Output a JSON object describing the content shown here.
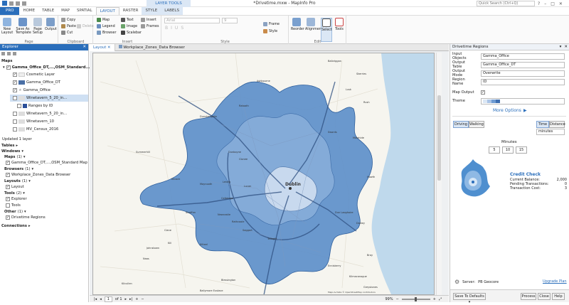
{
  "window": {
    "title": "*Drivetime.mxw - MapInfo Pro",
    "search_placeholder": "Quick Search (Ctrl+Q)",
    "contextual_tab": "LAYER TOOLS"
  },
  "ribbon_tabs": [
    "PRO",
    "HOME",
    "TABLE",
    "MAP",
    "SPATIAL",
    "LAYOUT",
    "RASTER",
    "STYLE",
    "LABELS"
  ],
  "ribbon": {
    "page": {
      "label": "Page",
      "new_layout": "New Layout",
      "save_as_template": "Save As Template",
      "page_setup": "Page Setup",
      "output": "Output"
    },
    "clipboard": {
      "label": "Clipboard",
      "copy": "Copy",
      "paste": "Paste",
      "cut": "Cut",
      "delete": "Delete"
    },
    "insert": {
      "label": "Insert",
      "map": "Map",
      "legend": "Legend",
      "browser": "Browser",
      "text": "Text",
      "image": "Image",
      "scalebar": "Scalebar",
      "insert": "Insert",
      "frames": "Frames"
    },
    "style": {
      "label": "Style",
      "font": "Arial",
      "size": "9",
      "frame": "Frame",
      "style": "Style"
    },
    "edit": {
      "label": "Edit",
      "reorder": "Reorder",
      "alignment": "Alignment",
      "select": "Select",
      "tools": "Tools"
    }
  },
  "explorer": {
    "title": "Explorer",
    "maps_header": "Maps",
    "map_name": "Gamma_Office_DT,...,OSM_Standard...",
    "layers": [
      {
        "name": "Cosmetic Layer",
        "checked": true
      },
      {
        "name": "Gamma_Office_DT",
        "checked": true
      },
      {
        "name": "Gamma_Office",
        "checked": true
      },
      {
        "name": "Winetavern_5_20_in...",
        "checked": false,
        "selected": true
      },
      {
        "name": "Ranges by ID",
        "checked": false
      },
      {
        "name": "Winetavern_5_20_in...",
        "checked": false
      },
      {
        "name": "Winetavern_10",
        "checked": false
      },
      {
        "name": "MV_Census_2016",
        "checked": false
      }
    ],
    "status": "Updated 1 layer",
    "tables_header": "Tables",
    "windows_header": "Windows",
    "maps_group": "Maps",
    "maps_count": "(1)",
    "maps_item": "Gamma_Office_DT,...,OSM_Standard Map",
    "browsers_group": "Browsers",
    "browsers_count": "(1)",
    "browsers_item": "Workplace_Zones_Data Browser",
    "layouts_group": "Layouts",
    "layouts_count": "(1)",
    "layouts_item": "Layout",
    "tools_group": "Tools",
    "tools_count": "(2)",
    "tools_items": [
      "Explorer",
      "Tools"
    ],
    "other_group": "Other",
    "other_count": "(1)",
    "other_item": "Drivetime Regions",
    "connections_header": "Connections"
  },
  "doc_tabs": [
    "Layout",
    "Workplace_Zones_Data Browser"
  ],
  "map": {
    "places": [
      "Dublin",
      "Skerries",
      "Balbriggan",
      "Rush",
      "Lusk",
      "Swords",
      "Malahide",
      "Howth",
      "Dunboyne",
      "Clonee",
      "Lucan",
      "Maynooth",
      "Leixlip",
      "Kilcock",
      "Celbridge",
      "Straffan",
      "Clane",
      "Naas",
      "Kill",
      "Johnstown",
      "Newcastle",
      "Rathcoole",
      "Saggart",
      "Tallaght",
      "Blessington",
      "Enniskerry",
      "Bray",
      "Greystones",
      "Dalkey",
      "Dun Laoghaire",
      "Ashbourne",
      "Ratoath",
      "Dunshaughlin",
      "Summerhill",
      "Kilcullen",
      "Kilteel",
      "Ballymore Eustace",
      "Kilmacanogue"
    ],
    "attribution": "Maps & Data © OpenStreetMap contributors"
  },
  "status_bar": {
    "page_current": "1",
    "page_of": "of 1",
    "zoom": "99%"
  },
  "panel": {
    "title": "Drivetime Regions",
    "fields": [
      {
        "label": "Input Objects",
        "value": "Gamma_Office"
      },
      {
        "label": "Output Table",
        "value": "Gamma_Office_DT"
      },
      {
        "label": "Output Mode",
        "value": "Overwrite"
      },
      {
        "label": "Region Name",
        "value": "ID"
      }
    ],
    "map_output_label": "Map Output",
    "theme_label": "Theme",
    "more_options": "More Options",
    "mode_driving": "Driving",
    "mode_walking": "Walking",
    "type_time": "Time",
    "type_distance": "Distance",
    "unit": "minutes",
    "minutes_label": "Minutes",
    "minutes": [
      "5",
      "10",
      "15"
    ],
    "credit_title": "Credit Check",
    "credit_rows": [
      {
        "label": "Current Balance:",
        "value": "2,000"
      },
      {
        "label": "Pending Transactions:",
        "value": "0"
      },
      {
        "label": "Transaction Cost:",
        "value": "3"
      }
    ],
    "server_label": "Server:",
    "server_value": "PB Geocore",
    "upgrade_link": "Upgrade Plan",
    "save_defaults": "Save To Defaults",
    "process": "Process",
    "close": "Close",
    "help": "Help"
  },
  "colors": {
    "accent": "#2a6ebb",
    "drive_15": "#5b8ec9",
    "drive_10": "#86acd8",
    "drive_5": "#c8d9ee"
  }
}
